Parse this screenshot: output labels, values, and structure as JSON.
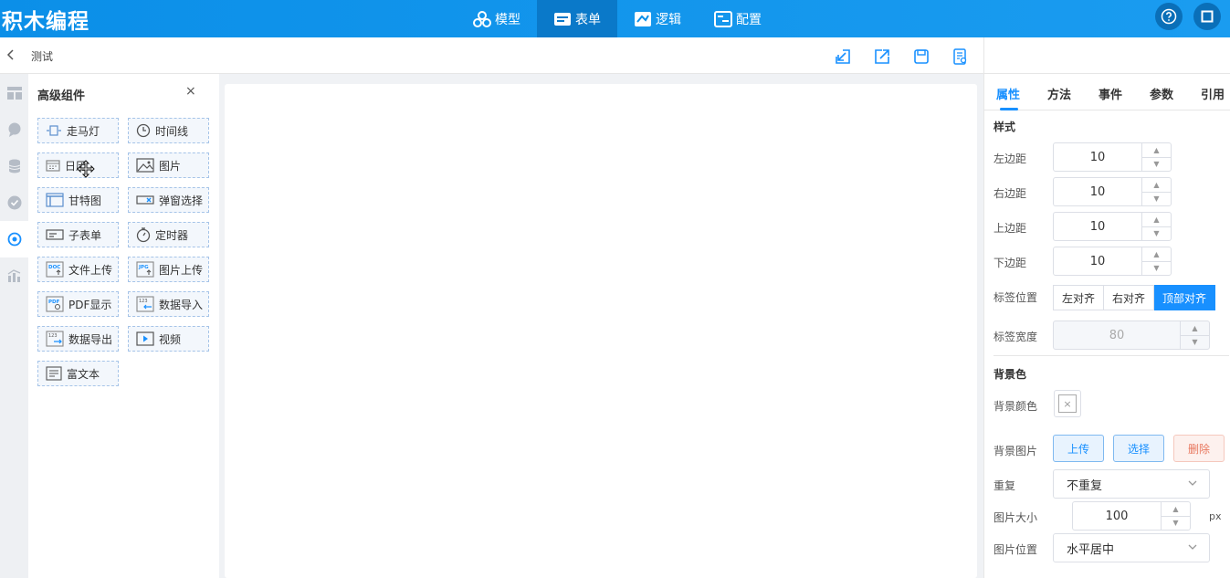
{
  "app": {
    "title": "积木编程"
  },
  "nav": [
    {
      "label": "模型"
    },
    {
      "label": "表单"
    },
    {
      "label": "逻辑"
    },
    {
      "label": "配置"
    }
  ],
  "subbar": {
    "page_name": "测试"
  },
  "panel": {
    "title": "高级组件",
    "close": "×"
  },
  "components": [
    {
      "label": "走马灯"
    },
    {
      "label": "时间线"
    },
    {
      "label": "日历"
    },
    {
      "label": "图片"
    },
    {
      "label": "甘特图"
    },
    {
      "label": "弹窗选择"
    },
    {
      "label": "子表单"
    },
    {
      "label": "定时器"
    },
    {
      "label": "文件上传"
    },
    {
      "label": "图片上传"
    },
    {
      "label": "PDF显示"
    },
    {
      "label": "数据导入"
    },
    {
      "label": "数据导出"
    },
    {
      "label": "视频"
    },
    {
      "label": "富文本"
    }
  ],
  "right_tabs": [
    {
      "label": "属性"
    },
    {
      "label": "方法"
    },
    {
      "label": "事件"
    },
    {
      "label": "参数"
    },
    {
      "label": "引用"
    }
  ],
  "style_section": {
    "title": "样式",
    "margin_left": {
      "label": "左边距",
      "value": "10"
    },
    "margin_right": {
      "label": "右边距",
      "value": "10"
    },
    "margin_top": {
      "label": "上边距",
      "value": "10"
    },
    "margin_bottom": {
      "label": "下边距",
      "value": "10"
    },
    "label_position": {
      "label": "标签位置",
      "options": [
        "左对齐",
        "右对齐",
        "顶部对齐"
      ],
      "selected": "顶部对齐"
    },
    "label_width": {
      "label": "标签宽度",
      "value": "80"
    }
  },
  "bg_section": {
    "title": "背景色",
    "bg_color": {
      "label": "背景颜色",
      "value": "×"
    },
    "bg_image": {
      "label": "背景图片",
      "upload": "上传",
      "choose": "选择",
      "delete": "删除"
    },
    "repeat": {
      "label": "重复",
      "value": "不重复"
    },
    "image_size": {
      "label": "图片大小",
      "value": "100",
      "unit": "px"
    },
    "image_position": {
      "label": "图片位置",
      "value": "水平居中"
    }
  },
  "colors": {
    "primary": "#1890ff",
    "topbar": "#0b8fe8",
    "danger": "#e8785f"
  }
}
